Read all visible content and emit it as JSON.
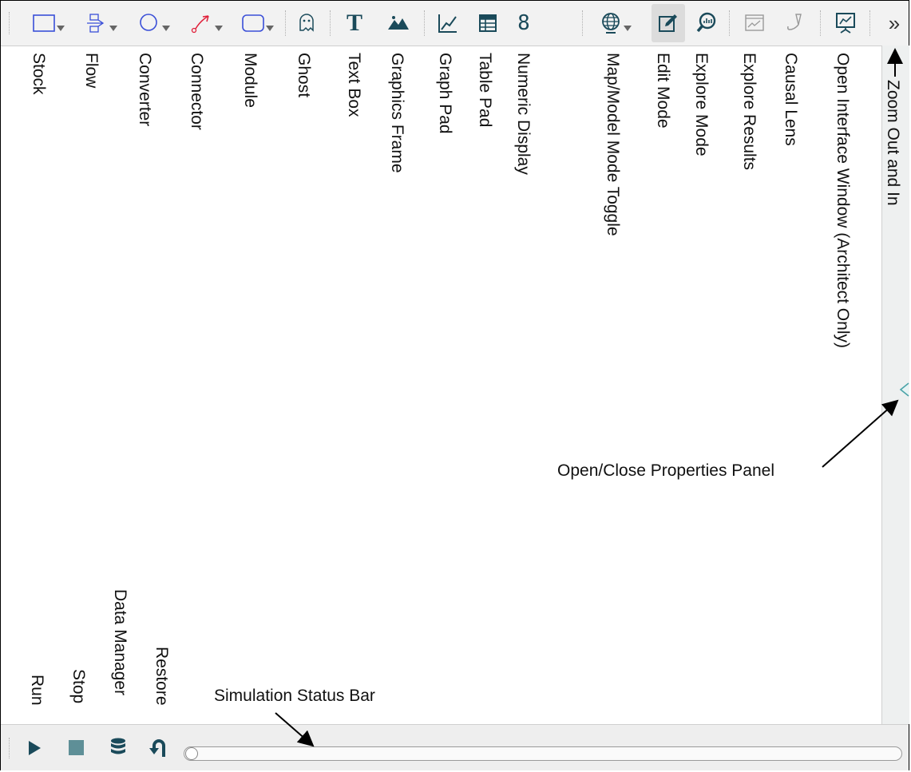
{
  "toolbar": {
    "more_glyph": "»",
    "tools": [
      {
        "icon": "stock-icon"
      },
      {
        "icon": "flow-icon"
      },
      {
        "icon": "converter-icon"
      },
      {
        "icon": "connector-icon"
      },
      {
        "icon": "module-icon"
      },
      {
        "icon": "ghost-icon"
      },
      {
        "icon": "text-box-icon"
      },
      {
        "icon": "graphics-frame-icon"
      },
      {
        "icon": "graph-pad-icon"
      },
      {
        "icon": "table-pad-icon"
      },
      {
        "icon": "numeric-display-icon"
      },
      {
        "icon": "map-model-toggle-icon"
      },
      {
        "icon": "edit-mode-icon"
      },
      {
        "icon": "explore-mode-icon"
      },
      {
        "icon": "explore-results-icon"
      },
      {
        "icon": "causal-lens-icon"
      },
      {
        "icon": "interface-window-icon"
      }
    ],
    "text_glyph": "T",
    "numeric_glyph": "8"
  },
  "labels": {
    "stock": "Stock",
    "flow": "Flow",
    "converter": "Converter",
    "connector": "Connector",
    "module": "Module",
    "ghost": "Ghost",
    "text_box": "Text Box",
    "graphics_frame": "Graphics Frame",
    "graph_pad": "Graph Pad",
    "table_pad": "Table Pad",
    "numeric_display": "Numeric Display",
    "map_model_toggle": "Map/Model Mode Toggle",
    "edit_mode": "Edit Mode",
    "explore_mode": "Explore Mode",
    "explore_results": "Explore Results",
    "causal_lens": "Causal Lens",
    "open_interface": "Open Interface Window (Architect Only)",
    "zoom": "Zoom Out and In",
    "properties_panel": "Open/Close Properties Panel",
    "run": "Run",
    "stop": "Stop",
    "data_manager": "Data Manager",
    "restore": "Restore",
    "status_bar": "Simulation Status Bar"
  },
  "colors": {
    "accent": "#1a4a5a",
    "stock_blue": "#3a4fd8",
    "connector_red": "#e0203a",
    "panel_teal": "#4aa3a8"
  }
}
